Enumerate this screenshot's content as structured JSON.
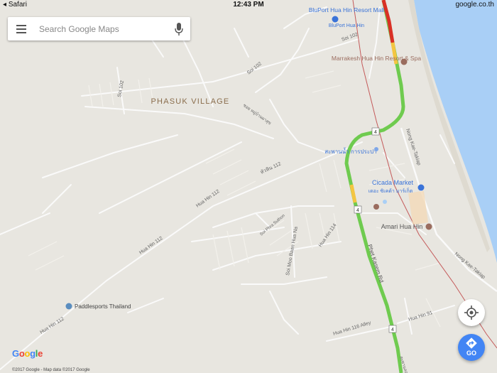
{
  "status_bar": {
    "back_app": "Safari",
    "time": "12:43 PM",
    "domain": "google.co.th"
  },
  "search": {
    "placeholder": "Search Google Maps"
  },
  "colors": {
    "land": "#e8e6e0",
    "water": "#a9cff6",
    "road_minor": "#ffffff",
    "highway_green": "#6fcb4f",
    "highway_yellow": "#f4c542",
    "highway_red": "#d93025",
    "railway": "#c45a5a",
    "poi_blue": "#3a73d8",
    "poi_brown": "#9a6c5e",
    "go_blue": "#4285f4"
  },
  "map": {
    "area_label": "PHASUK VILLAGE",
    "street_labels": [
      "Soi 102",
      "Soi 102",
      "Soi 102",
      "ซอย หมู่บ้านผาสุข",
      "หัวหิน 112",
      "Hua Hin 112",
      "Hua Hin 112",
      "Hua Hin 112",
      "Soi Phra Suthon",
      "Soi Moo Baan Hua Na",
      "Hua Hin 114",
      "Phet Kasem Rd",
      "Hua Hin 116 Alley",
      "Hua Hin 91",
      "Nong Kae-Takiap",
      "Nong Kae-Takiap",
      "สะพานลอยคนข้าม"
    ],
    "route_shield": "4",
    "places": [
      {
        "name": "BluPort Hua Hin Resort Mall",
        "sub": "BluPort Hua Hin",
        "icon": "shopping-icon"
      },
      {
        "name": "Marrakesh Hua Hin Resort & Spa",
        "icon": "hotel-icon"
      },
      {
        "name": "สะพานน้ำ การประปา",
        "icon": "landmark-icon"
      },
      {
        "name": "Cicada Market",
        "sub": "เดอะ ซิเคด้า มาร์เก็ต",
        "icon": "shopping-icon"
      },
      {
        "name": "Amari Hua Hin",
        "icon": "hotel-icon"
      },
      {
        "name": "Paddlesports Thailand",
        "icon": "pin-icon"
      }
    ]
  },
  "controls": {
    "go_label": "GO",
    "logo": "Google",
    "copyright": "©2017 Google - Map data ©2017 Google"
  }
}
